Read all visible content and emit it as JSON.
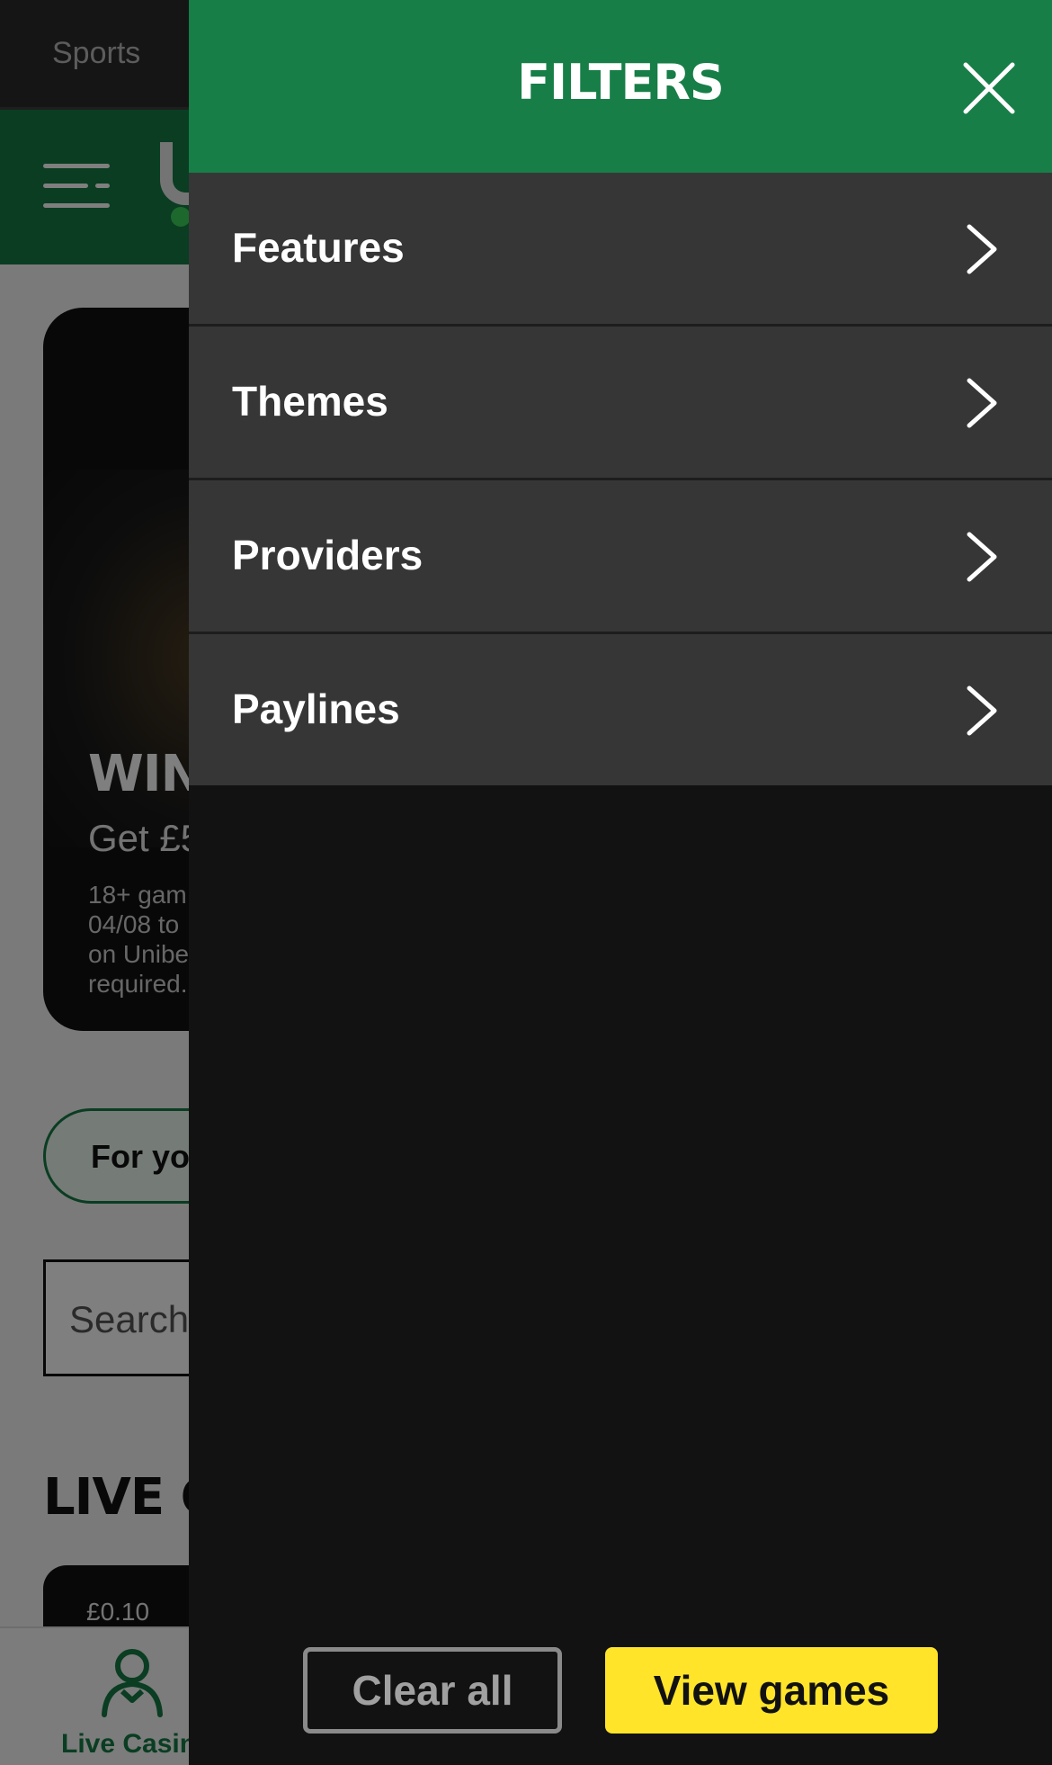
{
  "background": {
    "top_tab": "Sports",
    "promo": {
      "title": "WIN",
      "subtitle": "Get £5",
      "terms": "18+ gam\n04/08 to\non Unibe\nrequired."
    },
    "chip_label": "For you",
    "search_placeholder": "Search",
    "section_title": "LIVE CA",
    "game_card_price": "£0.10",
    "bottom_nav_label": "Live Casino"
  },
  "drawer": {
    "title": "FILTERS",
    "items": [
      {
        "label": "Features"
      },
      {
        "label": "Themes"
      },
      {
        "label": "Providers"
      },
      {
        "label": "Paylines"
      }
    ],
    "clear_label": "Clear all",
    "view_label": "View games"
  },
  "colors": {
    "brand_green": "#177e47",
    "cta_yellow": "#ffe42a",
    "drawer_bg": "#121212",
    "item_bg": "#363636"
  },
  "icons": {
    "close": "close-icon",
    "chevron": "chevron-right-icon",
    "menu": "hamburger-icon",
    "live_casino": "dealer-icon"
  }
}
